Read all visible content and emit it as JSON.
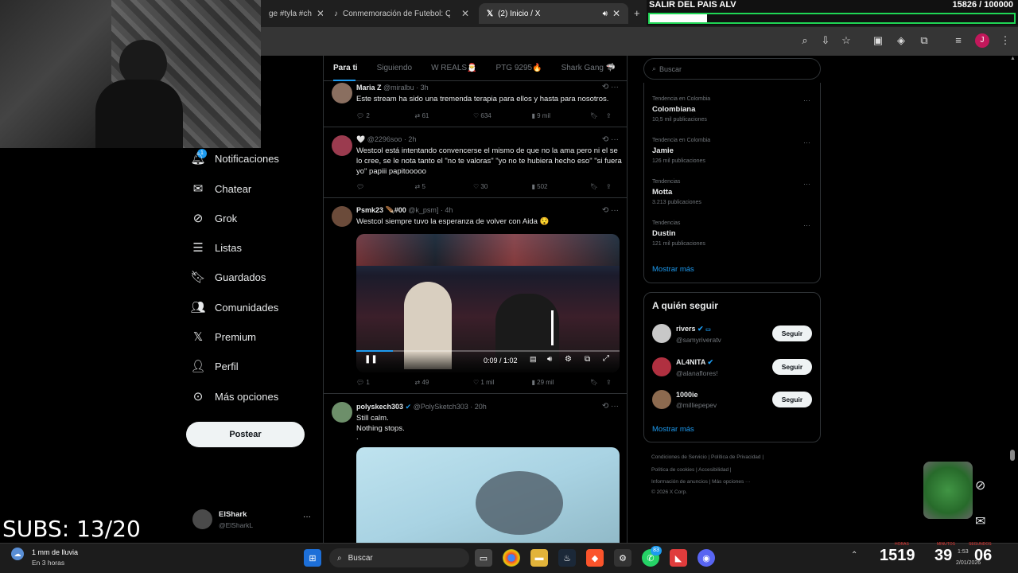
{
  "browser": {
    "tabs": [
      {
        "label": "ge #tyla #ch"
      },
      {
        "label": "Conmemoración de Futebol: Qu"
      },
      {
        "label": "(2) Inicio / X"
      }
    ],
    "profile_initial": "J"
  },
  "overlay": {
    "goal_title": "SALIR DEL PAIS ALV",
    "goal_count": "15826 / 100000",
    "goal_progress": 0.158,
    "subs": "SUBS: 13/20"
  },
  "nav": {
    "items": [
      {
        "label": "Notificaciones",
        "icon": "bell-icon"
      },
      {
        "label": "Chatear",
        "icon": "mail-icon"
      },
      {
        "label": "Grok",
        "icon": "grok-icon"
      },
      {
        "label": "Listas",
        "icon": "list-icon"
      },
      {
        "label": "Guardados",
        "icon": "bookmark-icon"
      },
      {
        "label": "Comunidades",
        "icon": "people-icon"
      },
      {
        "label": "Premium",
        "icon": "x-logo-icon"
      },
      {
        "label": "Perfil",
        "icon": "person-icon"
      },
      {
        "label": "Más opciones",
        "icon": "more-circle-icon"
      }
    ],
    "post_label": "Postear",
    "account_name": "ElShark",
    "account_handle": "@ElSharkL",
    "notif_badge": "1"
  },
  "feed": {
    "tabs": [
      "Para ti",
      "Siguiendo",
      "W REALS🎅",
      "PTG 9295🔥",
      "Shark Gang 🦈"
    ],
    "tweets": [
      {
        "name": "Maria Z",
        "meta": "@miralbu · 3h",
        "text": "Este stream ha sido una tremenda terapia para ellos y hasta para nosotros.",
        "replies": "2",
        "reposts": "61",
        "likes": "634",
        "views": "9 mil"
      },
      {
        "name": "🤍",
        "meta": "@2296soo · 2h",
        "text": "Westcol está intentando convencerse el mismo de que no la ama pero ni el se lo cree, se le nota tanto el \"no te valoras\" \"yo no te hubiera hecho eso\" \"si fuera yo\" papiii papitooooo",
        "replies": "",
        "reposts": "5",
        "likes": "30",
        "views": "502"
      },
      {
        "name": "Psmk23 🪶#00",
        "meta": "@k_psm] · 4h",
        "text": "Westcol siempre tuvo la esperanza de volver con Aida 😯",
        "replies": "1",
        "reposts": "49",
        "likes": "1 mil",
        "views": "29 mil",
        "video_time": "0:09 / 1:02",
        "video_progress": 0.14
      },
      {
        "name": "polyskech303",
        "meta": "@PolySketch303 · 20h",
        "text_lines": [
          "Still calm.",
          "Nothing stops.",
          "."
        ]
      }
    ]
  },
  "right": {
    "search_placeholder": "Buscar",
    "trends": [
      {
        "context": "Tendencia en Colombia",
        "name": "Colombiana",
        "count": "10,5 mil publicaciones"
      },
      {
        "context": "Tendencia en Colombia",
        "name": "Jamie",
        "count": "126 mil publicaciones"
      },
      {
        "context": "Tendencias",
        "name": "Motta",
        "count": "3.213 publicaciones"
      },
      {
        "context": "Tendencias",
        "name": "Dustin",
        "count": "121 mil publicaciones"
      }
    ],
    "show_more": "Mostrar más",
    "who_to_follow_title": "A quién seguir",
    "follow_suggestions": [
      {
        "name": "rivers",
        "handle": "@samyriveratv"
      },
      {
        "name": "AL4NITA",
        "handle": "@alanaflores!"
      },
      {
        "name": "1000ie",
        "handle": "@milliepepev"
      }
    ],
    "follow_label": "Seguir",
    "show_more_2": "Mostrar más",
    "footer_lines": [
      "Condiciones de Servicio  |  Política de Privacidad  |",
      "Política de cookies  |  Accesibilidad  |",
      "Información de anuncios  |  Más opciones ···",
      "© 2026 X Corp."
    ]
  },
  "taskbar": {
    "weather_temp": "1 mm de lluvia",
    "weather_sub": "En 3 horas",
    "search_label": "Buscar",
    "clock_time": "1:53",
    "clock_date": "2/01/2026",
    "timer_hours": "1519",
    "timer_minutes": "39",
    "timer_seconds": "06",
    "timer_labels": [
      "HORAS",
      "MINUTOS",
      "SEGUNDOS"
    ],
    "whatsapp_badge": "83"
  },
  "colors": {
    "accent": "#1d9bf0",
    "goal_green": "#1fd655",
    "background": "#000000"
  }
}
